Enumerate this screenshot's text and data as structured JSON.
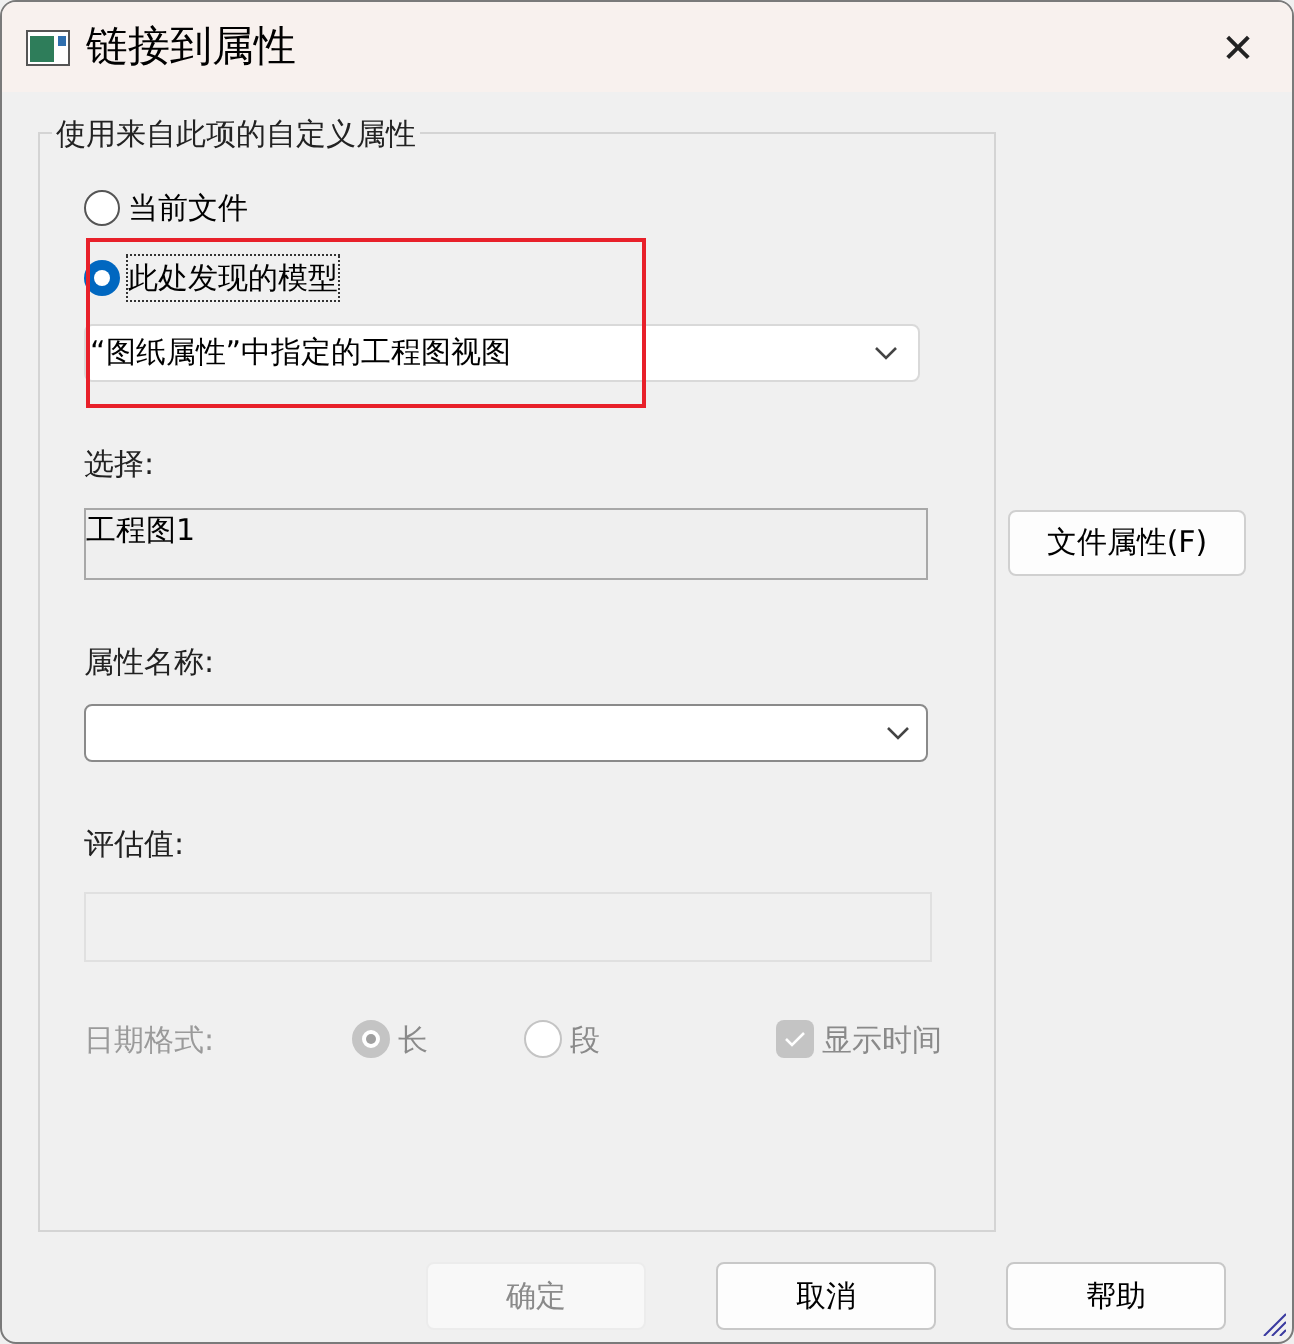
{
  "window": {
    "title": "链接到属性",
    "close": "✕"
  },
  "group": {
    "label": "使用来自此项的自定义属性",
    "sources": [
      {
        "label": "当前文件",
        "selected": false
      },
      {
        "label": "此处发现的模型",
        "selected": true
      }
    ],
    "model_dropdown": {
      "value": "“图纸属性”中指定的工程图视图"
    },
    "selection": {
      "label": "选择:",
      "value": "工程图1"
    },
    "property_name": {
      "label": "属性名称:"
    },
    "evaluated_value": {
      "label": "评估值:",
      "disabled": true
    },
    "date_format": {
      "label": "日期格式:",
      "disabled": true,
      "options": [
        {
          "label": "长",
          "selected": true
        },
        {
          "label": "段",
          "selected": false
        }
      ],
      "show_time": {
        "label": "显示时间",
        "checked": true
      }
    }
  },
  "file_properties_button": "文件属性(F)",
  "buttons": [
    {
      "label": "确定",
      "disabled": true
    },
    {
      "label": "取消",
      "disabled": false
    },
    {
      "label": "帮助",
      "disabled": false
    }
  ]
}
